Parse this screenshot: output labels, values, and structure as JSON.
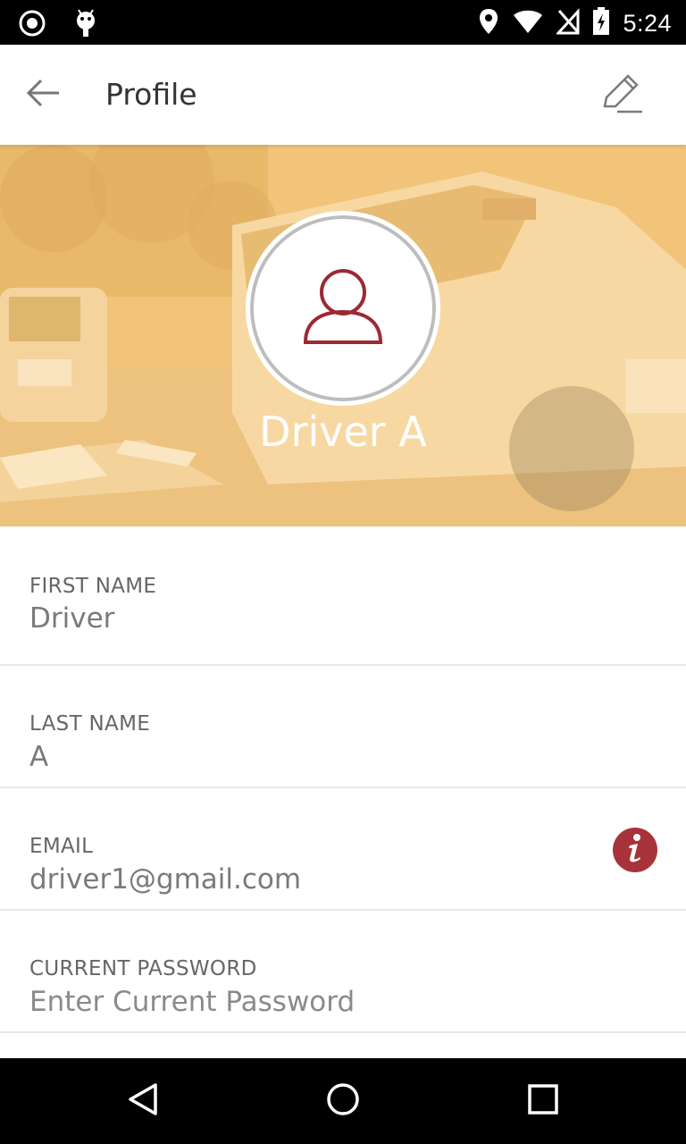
{
  "status_bar": {
    "time": "5:24",
    "icons": [
      "record-icon",
      "android-debug-icon",
      "location-icon",
      "wifi-icon",
      "no-sim-icon",
      "battery-charging-icon"
    ]
  },
  "app_bar": {
    "title": "Profile",
    "back_icon": "back-arrow-icon",
    "edit_icon": "pencil-edit-icon"
  },
  "header": {
    "driver_name": "Driver A",
    "avatar_icon": "user-outline-icon"
  },
  "form": {
    "fields": [
      {
        "label": "FIRST NAME",
        "value": "Driver"
      },
      {
        "label": "LAST NAME",
        "value": "A"
      },
      {
        "label": "EMAIL",
        "value": "driver1@gmail.com",
        "action_icon": "info-icon"
      },
      {
        "label": "CURRENT PASSWORD",
        "placeholder": "Enter Current Password"
      }
    ]
  },
  "nav_bar": {
    "buttons": [
      "back-triangle-icon",
      "home-circle-icon",
      "recents-square-icon"
    ]
  },
  "colors": {
    "header_tint": "#f1c47a",
    "accent_red": "#a8323a",
    "label_gray": "#666666"
  }
}
